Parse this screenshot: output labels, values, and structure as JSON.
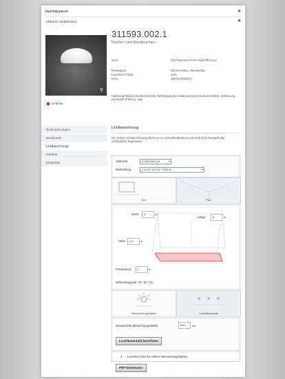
{
  "header": {
    "product_name": "Flat Polymero®",
    "article_line": "Artikel-Nr. 311593.002.1",
    "close_icon": "close-icon",
    "pin_icon": "pin-icon"
  },
  "product": {
    "article_number": "311593.002.1",
    "subtitle": "Decken- und Wandleuchten",
    "availability": "Lieferbar",
    "availability_color": "#d42222",
    "specs": [
      {
        "key": "Serie",
        "value": "Flat Polymero® LED High Efficiency"
      },
      {
        "key": "",
        "value": ""
      },
      {
        "key": "Montageart",
        "value": "Deckenanbau, Wandanbau"
      },
      {
        "key": "Leuchtens Farbe",
        "value": "weiß"
      },
      {
        "key": "EAN",
        "value": "4007841000001"
      }
    ],
    "description": "Halterung Metall pulverbeschichtet, Befestigung der Abdeckung mit Druckverschluss. Abdeckung Kunststoff (PMMA), opal."
  },
  "sidebar": {
    "items": [
      {
        "label": "Technische Daten"
      },
      {
        "label": "Downloads"
      },
      {
        "label": "Lichtberechnung"
      },
      {
        "label": "Zubehör"
      },
      {
        "label": "Ersatzteile"
      }
    ]
  },
  "calc": {
    "title": "Lichtberechnung",
    "intro": "Die Online-Lichtberechnung dient nur zur Schnellkalkulation und stellt nicht zwangsläufig verbindliche Ergebnisse.",
    "form": {
      "article_label": "Artikel-Nr.",
      "article_value": "311593.002.1 ▾",
      "lamp_label": "Bestückung",
      "lamp_value": "1 x LED 16,5 W / 2000 lm"
    },
    "room_types": [
      {
        "label": "Box"
      },
      {
        "label": "Flat"
      }
    ],
    "room": {
      "width_label": "Breite",
      "width_value": "5",
      "length_label": "Länge",
      "length_value": "6",
      "height_label": "Höhe",
      "height_value": "2,8",
      "workplane_label": "Freiabstand",
      "workplane_value": "0",
      "unit": "m",
      "reflection_label": "Reflexionsgrade: 70 / 50 / 20"
    },
    "modes": [
      {
        "label": "Beleuchtungsstärke"
      },
      {
        "label": "Leuchtenanzahl"
      }
    ],
    "result": {
      "target_label": "Gewünschte Beleuchtungsstärke",
      "target_value": "300",
      "target_unit": "lux",
      "compute_button": "Leuchtenanzahl berechnen"
    },
    "luminaires": {
      "count": "3",
      "text": "Leuchten (312 lux mittlere Beleuchtungsstärke)"
    },
    "pdf_button": "PDF-Download ▸"
  }
}
